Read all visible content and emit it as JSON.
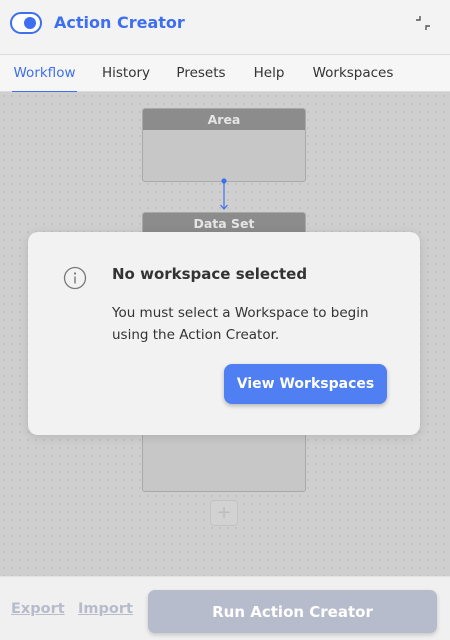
{
  "header": {
    "title": "Action Creator",
    "toggle_icon": "toggle-on-icon",
    "collapse_icon": "collapse-icon",
    "accent_color": "#3d6ff0"
  },
  "tabs": [
    {
      "label": "Workflow",
      "active": true
    },
    {
      "label": "History",
      "active": false
    },
    {
      "label": "Presets",
      "active": false
    },
    {
      "label": "Help",
      "active": false
    },
    {
      "label": "Workspaces",
      "active": false
    }
  ],
  "canvas": {
    "nodes": [
      {
        "label": "Area"
      },
      {
        "label": "Data Set"
      }
    ],
    "add_icon": "add-node-icon"
  },
  "modal": {
    "icon": "info-icon",
    "title": "No workspace selected",
    "message": "You must select a Workspace to begin using the Action Creator.",
    "button_label": "View Workspaces",
    "button_color": "#4f7ff2"
  },
  "footer": {
    "export_label": "Export",
    "import_label": "Import",
    "run_label": "Run Action Creator",
    "disabled_color": "#b7bccc"
  }
}
